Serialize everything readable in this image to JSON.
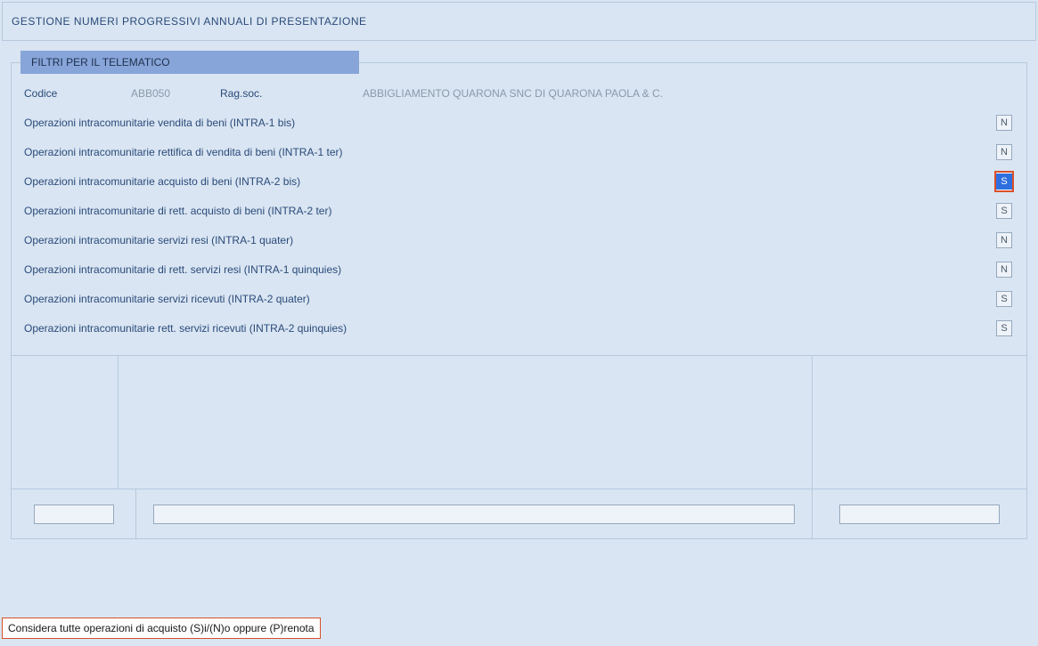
{
  "title": "GESTIONE NUMERI PROGRESSIVI ANNUALI DI PRESENTAZIONE",
  "group_legend": "FILTRI PER IL TELEMATICO",
  "codice": {
    "label": "Codice",
    "value": "ABB050"
  },
  "ragsoc": {
    "label": "Rag.soc.",
    "value": "ABBIGLIAMENTO QUARONA SNC DI QUARONA PAOLA & C."
  },
  "operations": [
    {
      "label": "Operazioni intracomunitarie vendita di beni (INTRA-1 bis)",
      "flag": "N",
      "highlighted": false
    },
    {
      "label": "Operazioni intracomunitarie rettifica di vendita di beni (INTRA-1 ter)",
      "flag": "N",
      "highlighted": false
    },
    {
      "label": "Operazioni intracomunitarie acquisto di beni (INTRA-2 bis)",
      "flag": "S",
      "highlighted": true
    },
    {
      "label": "Operazioni intracomunitarie di rett. acquisto di beni (INTRA-2 ter)",
      "flag": "S",
      "highlighted": false
    },
    {
      "label": "Operazioni intracomunitarie servizi resi (INTRA-1 quater)",
      "flag": "N",
      "highlighted": false
    },
    {
      "label": "Operazioni intracomunitarie di rett. servizi resi (INTRA-1 quinquies)",
      "flag": "N",
      "highlighted": false
    },
    {
      "label": "Operazioni intracomunitarie servizi ricevuti (INTRA-2 quater)",
      "flag": "S",
      "highlighted": false
    },
    {
      "label": "Operazioni intracomunitarie rett. servizi ricevuti (INTRA-2 quinquies)",
      "flag": "S",
      "highlighted": false
    }
  ],
  "status_hint": "Considera tutte operazioni di acquisto  (S)i/(N)o oppure (P)renota"
}
